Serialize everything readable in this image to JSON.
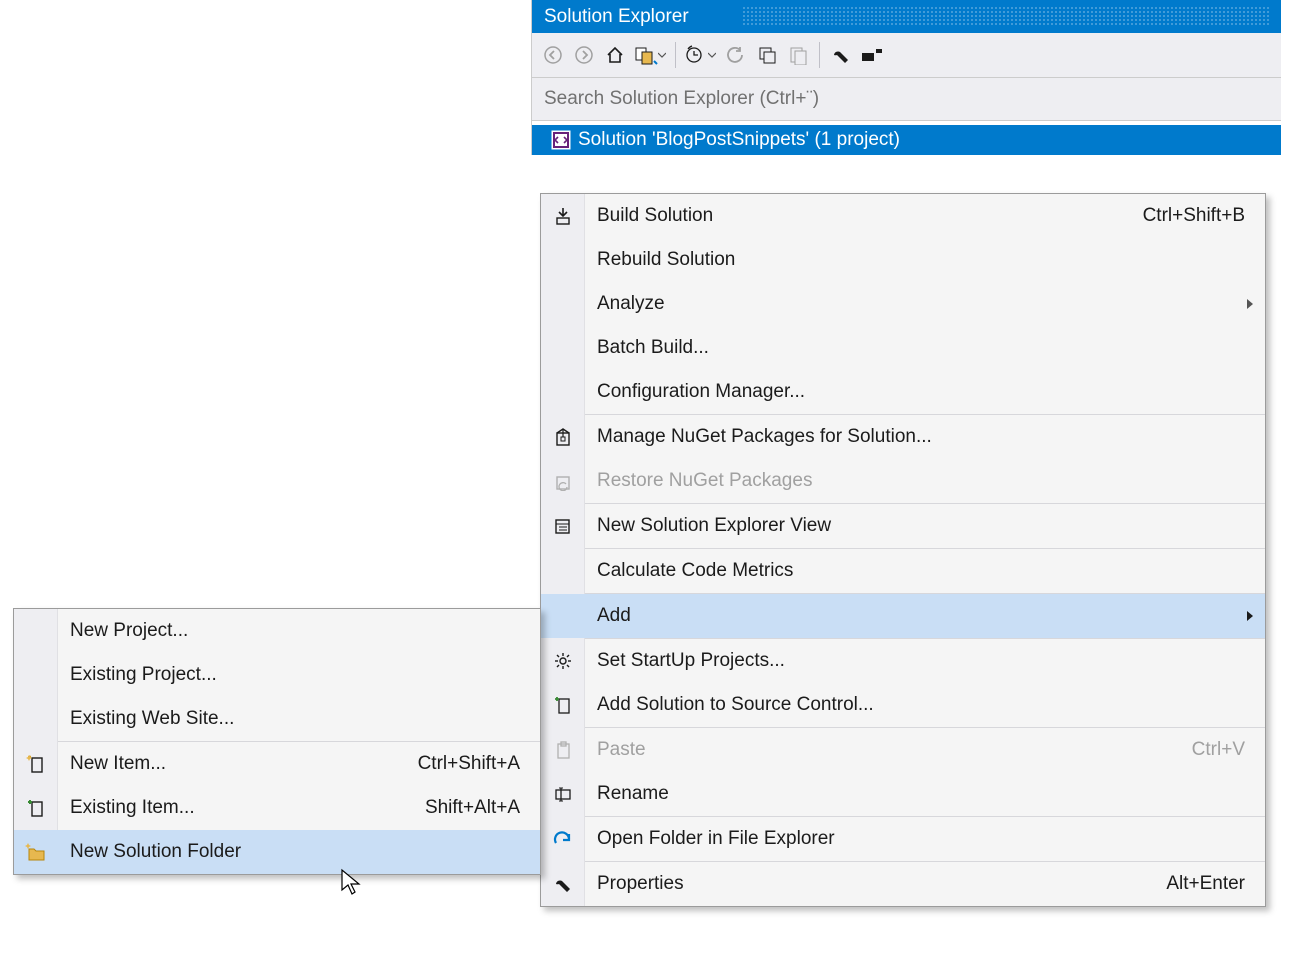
{
  "panel": {
    "title": "Solution Explorer",
    "search_placeholder": "Search Solution Explorer (Ctrl+¨)",
    "solution_label": "Solution 'BlogPostSnippets' (1 project)"
  },
  "toolbar_icons": [
    "back-icon",
    "forward-icon",
    "home-icon",
    "sync-views-icon",
    "dropdown-icon",
    "sep",
    "pending-changes-icon",
    "dropdown-icon",
    "refresh-icon",
    "collapse-all-icon",
    "show-all-files-icon",
    "sep",
    "properties-icon",
    "preview-icon"
  ],
  "context_menu": [
    {
      "label": "Build Solution",
      "shortcut": "Ctrl+Shift+B",
      "icon": "build-icon"
    },
    {
      "label": "Rebuild Solution"
    },
    {
      "label": "Analyze",
      "submenu": true
    },
    {
      "label": "Batch Build..."
    },
    {
      "label": "Configuration Manager..."
    },
    {
      "sep": true
    },
    {
      "label": "Manage NuGet Packages for Solution...",
      "icon": "nuget-icon"
    },
    {
      "label": "Restore NuGet Packages",
      "icon": "nuget-restore-icon",
      "disabled": true
    },
    {
      "sep": true
    },
    {
      "label": "New Solution Explorer View",
      "icon": "new-view-icon"
    },
    {
      "sep": true
    },
    {
      "label": "Calculate Code Metrics"
    },
    {
      "sep": true
    },
    {
      "label": "Add",
      "submenu": true,
      "hover": true
    },
    {
      "sep": true
    },
    {
      "label": "Set StartUp Projects...",
      "icon": "gear-icon"
    },
    {
      "label": "Add Solution to Source Control...",
      "icon": "add-source-control-icon"
    },
    {
      "sep": true
    },
    {
      "label": "Paste",
      "shortcut": "Ctrl+V",
      "icon": "paste-icon",
      "disabled": true
    },
    {
      "label": "Rename",
      "icon": "rename-icon"
    },
    {
      "sep": true
    },
    {
      "label": "Open Folder in File Explorer",
      "icon": "open-folder-icon"
    },
    {
      "sep": true
    },
    {
      "label": "Properties",
      "shortcut": "Alt+Enter",
      "icon": "wrench-icon"
    }
  ],
  "submenu": [
    {
      "label": "New Project..."
    },
    {
      "label": "Existing Project..."
    },
    {
      "label": "Existing Web Site..."
    },
    {
      "sep": true
    },
    {
      "label": "New Item...",
      "shortcut": "Ctrl+Shift+A",
      "icon": "new-item-icon"
    },
    {
      "label": "Existing Item...",
      "shortcut": "Shift+Alt+A",
      "icon": "existing-item-icon"
    },
    {
      "label": "New Solution Folder",
      "icon": "new-folder-icon",
      "hover": true
    }
  ]
}
